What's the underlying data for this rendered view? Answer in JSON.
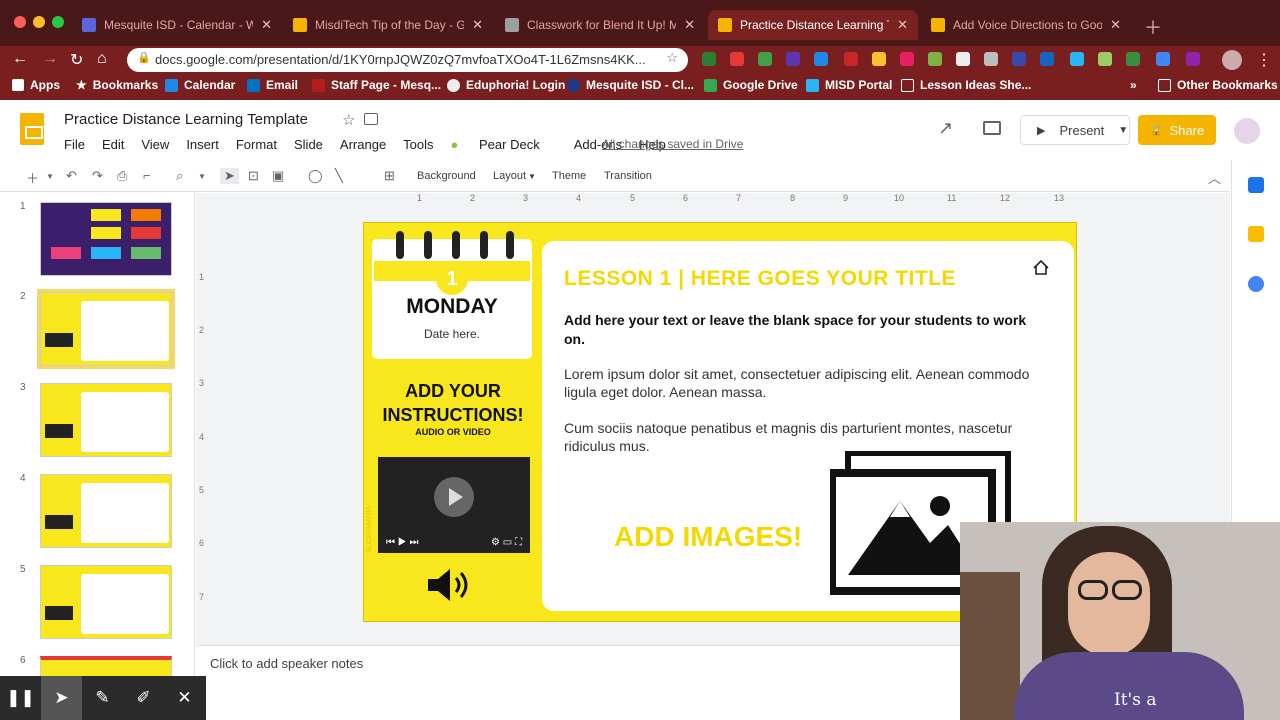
{
  "browser": {
    "tabs": [
      {
        "title": "Mesquite ISD - Calendar - We",
        "color": "#5a67d8",
        "active": false
      },
      {
        "title": "MisdiTech Tip of the Day - Go",
        "color": "#f4b400",
        "active": false
      },
      {
        "title": "Classwork for Blend It Up! Mo",
        "color": "#9e9e9e",
        "active": false
      },
      {
        "title": "Practice Distance Learning Ter",
        "color": "#f4b400",
        "active": true
      },
      {
        "title": "Add Voice Directions to Googl",
        "color": "#f4b400",
        "active": false
      }
    ],
    "url": "docs.google.com/presentation/d/1KY0rnpJQWZ0zQ7mvfoaTXOo4T-1L6Zmsns4KK...",
    "bookmarks": [
      "Apps",
      "Bookmarks",
      "Calendar",
      "Email",
      "Staff Page - Mesq...",
      "Eduphoria! Login",
      "Mesquite ISD - Cl...",
      "Google Drive",
      "MISD Portal",
      "Lesson Ideas She..."
    ],
    "other_bookmarks": "Other Bookmarks",
    "more": "»"
  },
  "app": {
    "title": "Practice Distance Learning Template",
    "menus": [
      "File",
      "Edit",
      "View",
      "Insert",
      "Format",
      "Slide",
      "Arrange",
      "Tools",
      "Pear Deck",
      "Add-ons",
      "Help"
    ],
    "saved_status": "All changes saved in Drive",
    "present_label": "Present",
    "share_label": "Share",
    "toolbar": {
      "background": "Background",
      "layout": "Layout",
      "theme": "Theme",
      "transition": "Transition"
    }
  },
  "ruler": {
    "h": [
      "1",
      "2",
      "3",
      "4",
      "5",
      "6",
      "7",
      "8",
      "9",
      "10",
      "11",
      "12",
      "13"
    ],
    "v": [
      "1",
      "2",
      "3",
      "4",
      "5",
      "6",
      "7"
    ]
  },
  "thumbnails": [
    {
      "num": "1",
      "selected": false
    },
    {
      "num": "2",
      "selected": true
    },
    {
      "num": "3",
      "selected": false
    },
    {
      "num": "4",
      "selected": false
    },
    {
      "num": "5",
      "selected": false
    },
    {
      "num": "6",
      "selected": false
    }
  ],
  "slide": {
    "day_number": "1",
    "day": "MONDAY",
    "date_placeholder": "Date here.",
    "instructions_title": "ADD YOUR INSTRUCTIONS!",
    "instructions_sub": "AUDIO OR VIDEO",
    "lesson_title": "LESSON 1 | HERE GOES YOUR TITLE",
    "lead": "Add here your text or leave the blank space for your students to work on.",
    "para1": "Lorem ipsum dolor sit amet, consectetuer adipiscing elit. Aenean commodo ligula eget dolor. Aenean massa.",
    "para2": "Cum sociis natoque penatibus et magnis dis parturient montes, nascetur ridiculus mus.",
    "add_images": "ADD IMAGES!",
    "side_text": "SLIDESMANIA"
  },
  "notes_placeholder": "Click to add speaker notes",
  "webcam": {
    "shirt_text": "It's a"
  },
  "colors": {
    "slide_yellow": "#f8e71c",
    "accent_yellow": "#f4d800",
    "chrome_red": "#7a1f1f"
  }
}
